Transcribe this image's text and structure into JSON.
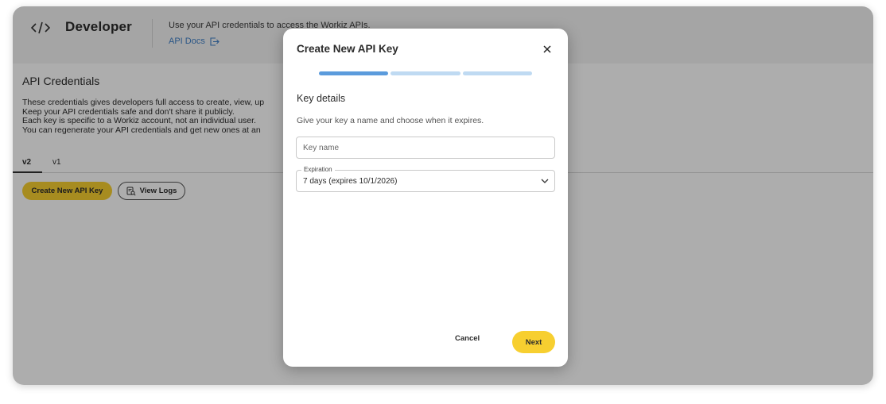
{
  "header": {
    "title": "Developer",
    "description": "Use your API credentials to access the Workiz APIs.",
    "api_docs_label": "API Docs",
    "code_icon": "code-icon",
    "external_link_icon": "external-link-icon"
  },
  "section": {
    "title": "API Credentials",
    "lines": [
      "These credentials gives developers full access to create, view, up",
      "Keep your API credentials safe and don't share it publicly.",
      "Each key is specific to a Workiz account, not an individual user.",
      "You can regenerate your API credentials and get new ones at an"
    ]
  },
  "tabs": [
    {
      "label": "v2",
      "active": true
    },
    {
      "label": "v1",
      "active": false
    }
  ],
  "actions": {
    "create_label": "Create New API Key",
    "logs_label": "View Logs",
    "logs_icon": "logs-search-icon"
  },
  "modal": {
    "title": "Create New API Key",
    "progress": {
      "steps": 3,
      "current": 1
    },
    "step_title": "Key details",
    "step_subtitle": "Give your key a name and choose when it expires.",
    "key_name_placeholder": "Key name",
    "expiration_label": "Expiration",
    "expiration_value": "7 days (expires 10/1/2026)",
    "cancel_label": "Cancel",
    "next_label": "Next"
  },
  "colors": {
    "accent_yellow": "#f7cf30",
    "progress_active": "#5b9bdc",
    "progress_inactive": "#bfdaf2",
    "link_blue": "#3f7fc6"
  }
}
